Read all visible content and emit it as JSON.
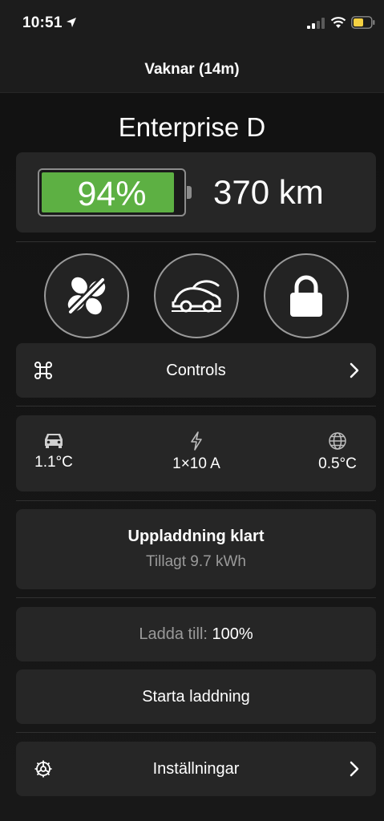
{
  "status_bar": {
    "time": "10:51",
    "icons": [
      "location-arrow-icon",
      "cellular-signal-icon",
      "wifi-icon",
      "battery-icon"
    ],
    "battery_color": "#f5d142"
  },
  "nav": {
    "title": "Vaknar (14m)"
  },
  "vehicle": {
    "name": "Enterprise D",
    "battery_percent_label": "94%",
    "battery_level": 0.94,
    "battery_color": "#5db043",
    "range": "370 km"
  },
  "quick_actions": [
    {
      "name": "climate-off-button",
      "icon": "fan-off-icon"
    },
    {
      "name": "trunk-button",
      "icon": "car-frunk-icon"
    },
    {
      "name": "lock-button",
      "icon": "lock-icon"
    }
  ],
  "controls": {
    "label": "Controls",
    "icon": "command-icon"
  },
  "stats": {
    "inside_temp": "1.1°C",
    "charge_rate": "1×10 A",
    "outside_temp": "0.5°C"
  },
  "charging": {
    "title": "Uppladdning klart",
    "added": "Tillagt 9.7 kWh"
  },
  "charge_limit": {
    "label": "Ladda till:",
    "value": "100%"
  },
  "start_charging": {
    "label": "Starta laddning"
  },
  "settings": {
    "label": "Inställningar",
    "icon": "gear-icon"
  }
}
